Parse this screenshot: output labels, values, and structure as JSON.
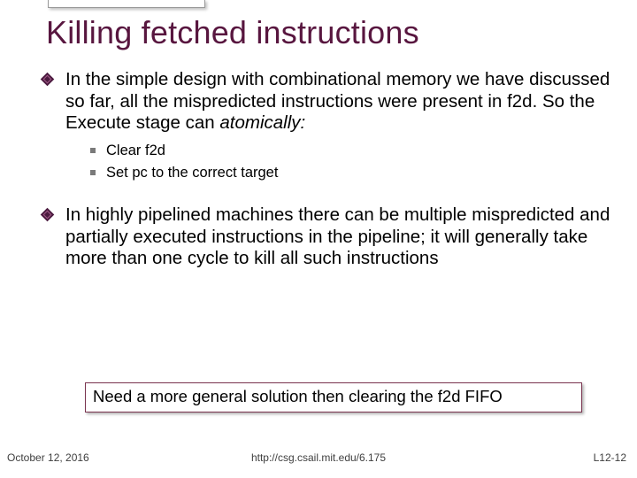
{
  "title": "Killing fetched instructions",
  "bullets": [
    {
      "level": 1,
      "text": "In the simple design with combinational memory we have discussed so far, all the mispredicted instructions were present in f2d. So the Execute stage can ",
      "italic_suffix": "atomically:"
    }
  ],
  "sub_bullets": [
    "Clear f2d",
    "Set pc to the correct target"
  ],
  "bullet2": "In highly pipelined machines there can be multiple mispredicted and partially executed instructions in the pipeline; it will generally take more than one cycle to kill all such instructions",
  "callout": "Need a more general solution then clearing the f2d FIFO",
  "footer": {
    "left": "October 12, 2016",
    "center": "http://csg.csail.mit.edu/6.175",
    "right": "L12-12"
  }
}
